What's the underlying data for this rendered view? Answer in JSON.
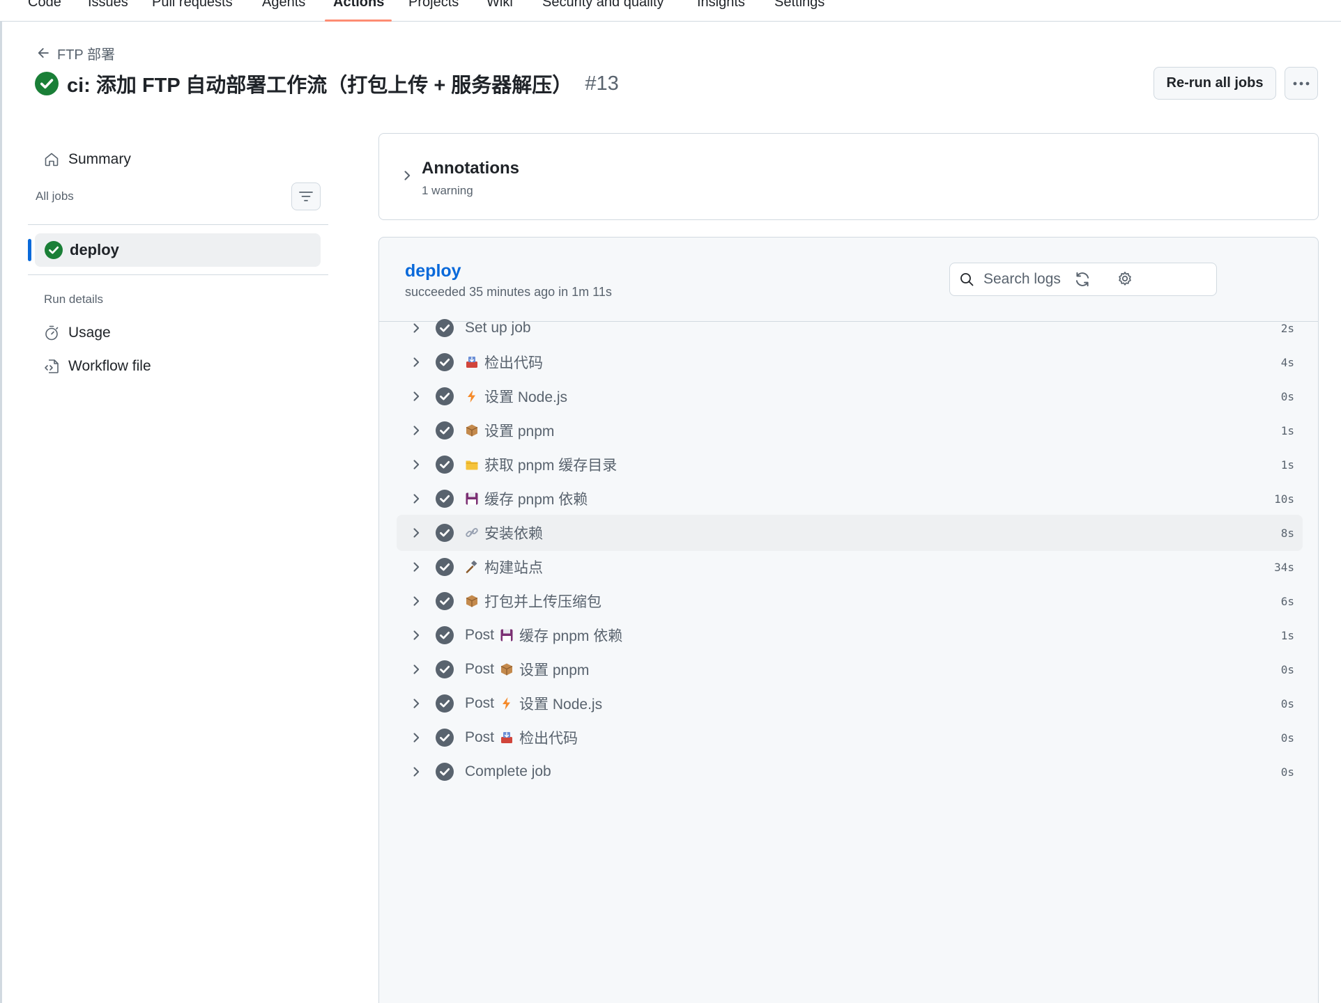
{
  "nav": {
    "tabs": [
      "Code",
      "Issues",
      "Pull requests",
      "Agents",
      "Actions",
      "Projects",
      "Wiki",
      "Security and quality",
      "Insights",
      "Settings"
    ],
    "active_tab": "Actions"
  },
  "header": {
    "back_label": "FTP 部署",
    "title": "ci: 添加 FTP 自动部署工作流（打包上传 + 服务器解压）",
    "run_number": "#13",
    "rerun_label": "Re-run all jobs"
  },
  "sidebar": {
    "summary_label": "Summary",
    "all_jobs_label": "All jobs",
    "jobs": [
      {
        "name": "deploy",
        "status": "success"
      }
    ],
    "run_details_label": "Run details",
    "details": [
      {
        "label": "Usage",
        "icon": "stopwatch-icon"
      },
      {
        "label": "Workflow file",
        "icon": "file-code-icon"
      }
    ]
  },
  "annotations": {
    "title": "Annotations",
    "subtitle": "1 warning"
  },
  "job": {
    "name": "deploy",
    "status_text": "succeeded 35 minutes ago in 1m 11s",
    "search_placeholder": "Search logs",
    "steps": [
      {
        "prefix": "",
        "emoji": "",
        "name": "Set up job",
        "duration": "2s"
      },
      {
        "prefix": "",
        "emoji": "inbox-tray-icon",
        "name": "检出代码",
        "duration": "4s"
      },
      {
        "prefix": "",
        "emoji": "lightning-icon",
        "name": "设置 Node.js",
        "duration": "0s"
      },
      {
        "prefix": "",
        "emoji": "package-icon",
        "name": "设置 pnpm",
        "duration": "1s"
      },
      {
        "prefix": "",
        "emoji": "folder-icon",
        "name": "获取 pnpm 缓存目录",
        "duration": "1s"
      },
      {
        "prefix": "",
        "emoji": "floppy-disk-icon",
        "name": "缓存 pnpm 依赖",
        "duration": "10s"
      },
      {
        "prefix": "",
        "emoji": "link-icon",
        "name": "安装依赖",
        "duration": "8s"
      },
      {
        "prefix": "",
        "emoji": "hammer-icon",
        "name": "构建站点",
        "duration": "34s"
      },
      {
        "prefix": "",
        "emoji": "package-icon",
        "name": "打包并上传压缩包",
        "duration": "6s"
      },
      {
        "prefix": "Post",
        "emoji": "floppy-disk-icon",
        "name": "缓存 pnpm 依赖",
        "duration": "1s"
      },
      {
        "prefix": "Post",
        "emoji": "package-icon",
        "name": "设置 pnpm",
        "duration": "0s"
      },
      {
        "prefix": "Post",
        "emoji": "lightning-icon",
        "name": "设置 Node.js",
        "duration": "0s"
      },
      {
        "prefix": "Post",
        "emoji": "inbox-tray-icon",
        "name": "检出代码",
        "duration": "0s"
      },
      {
        "prefix": "",
        "emoji": "",
        "name": "Complete job",
        "duration": "0s"
      }
    ]
  },
  "colors": {
    "success": "#1a7f37",
    "step_check": "#59636e",
    "accent": "#0969da",
    "active_tab_underline": "#fd8c73"
  }
}
